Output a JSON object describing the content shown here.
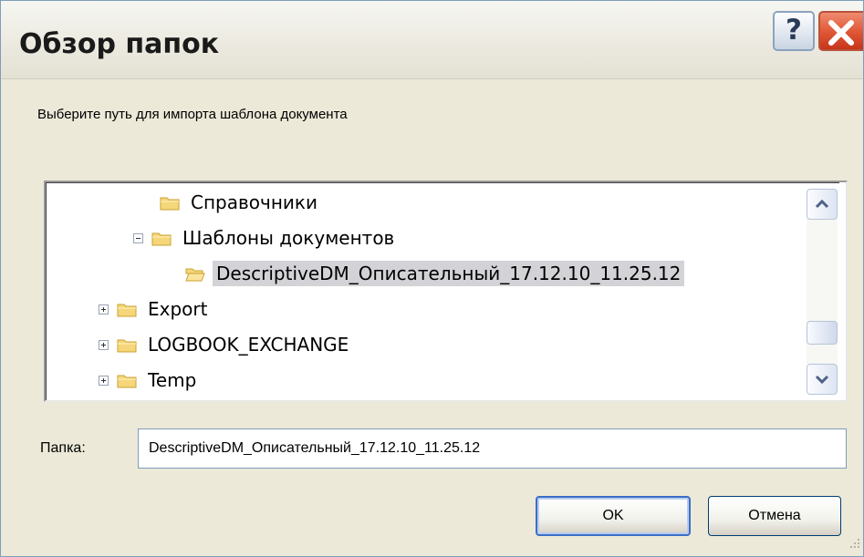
{
  "window": {
    "title": "Обзор папок",
    "help_label": "?"
  },
  "prompt": "Выберите путь для импорта шаблона документа",
  "tree": {
    "items": [
      {
        "label": "Справочники",
        "expander": "none",
        "selected": false
      },
      {
        "label": "Шаблоны документов",
        "expander": "minus",
        "selected": false
      },
      {
        "label": "DescriptiveDM_Описательный_17.12.10_11.25.12",
        "expander": "none",
        "selected": true,
        "open_folder": true
      },
      {
        "label": "Export",
        "expander": "plus",
        "selected": false
      },
      {
        "label": "LOGBOOK_EXCHANGE",
        "expander": "plus",
        "selected": false
      },
      {
        "label": "Temp",
        "expander": "plus",
        "selected": false
      }
    ]
  },
  "folder": {
    "label": "Папка:",
    "value": "DescriptiveDM_Описательный_17.12.10_11.25.12"
  },
  "buttons": {
    "ok": "OK",
    "cancel": "Отмена"
  },
  "colors": {
    "dialog_bg": "#ece9d8",
    "selection": "#d3d3d7",
    "close_red": "#e05a3a",
    "default_button_border": "#3b6ec7"
  },
  "icons": [
    "help-icon",
    "close-icon",
    "folder-icon",
    "folder-open-icon",
    "expand-icon",
    "collapse-icon",
    "scroll-up-icon",
    "scroll-down-icon",
    "resize-grip-icon"
  ]
}
